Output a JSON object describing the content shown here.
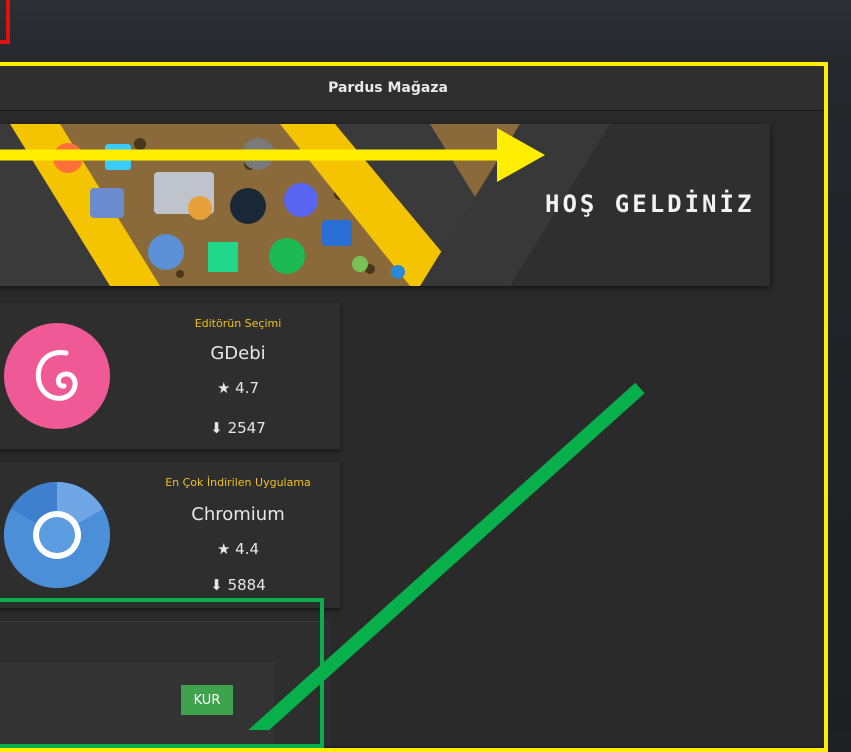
{
  "window": {
    "title": "Pardus Mağaza"
  },
  "banner": {
    "welcome_text": "HOŞ GELDİNİZ"
  },
  "featured": [
    {
      "tag": "Editörün Seçimi",
      "name": "GDebi",
      "rating": "★ 4.7",
      "downloads": "2547",
      "icon": "debian-swirl-icon",
      "icon_color": "#ef5a96"
    },
    {
      "tag": "En Çok İndirilen Uygulama",
      "name": "Chromium",
      "rating": "★ 4.4",
      "downloads": "5884",
      "icon": "chromium-icon",
      "icon_color": "#4b8fd9"
    }
  ],
  "install": {
    "label": "KUR"
  },
  "colors": {
    "accent_yellow": "#ffee00",
    "accent_green": "#08b04c",
    "tag_color": "#f0c020",
    "install_green": "#3fa34d",
    "corner_red": "#e01010"
  }
}
